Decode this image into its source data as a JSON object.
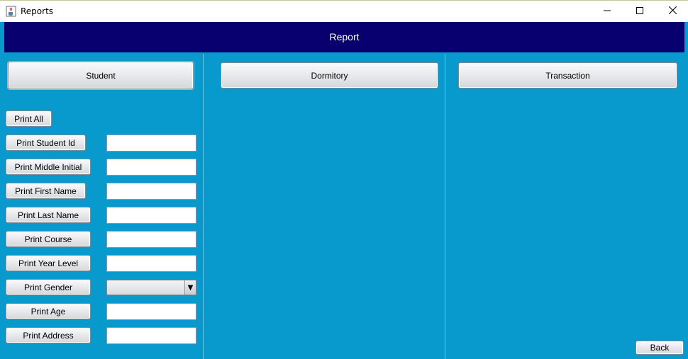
{
  "window": {
    "title": "Reports",
    "minimize_glyph": "─",
    "close_glyph": "✕"
  },
  "header": {
    "title": "Report"
  },
  "tabs": {
    "student": "Student",
    "dormitory": "Dormitory",
    "transaction": "Transaction"
  },
  "student_panel": {
    "print_all": "Print All",
    "rows": [
      {
        "label": "Print Student Id",
        "value": ""
      },
      {
        "label": "Print Middle Initial",
        "value": ""
      },
      {
        "label": "Print First Name",
        "value": ""
      },
      {
        "label": "Print Last Name",
        "value": ""
      },
      {
        "label": "Print Course",
        "value": ""
      },
      {
        "label": "Print Year Level",
        "value": ""
      },
      {
        "label": "Print Gender",
        "value": ""
      },
      {
        "label": "Print Age",
        "value": ""
      },
      {
        "label": "Print Address",
        "value": ""
      }
    ],
    "gender_arrow": "▼"
  },
  "footer": {
    "back": "Back"
  },
  "colors": {
    "panel_bg": "#0899cd",
    "header_bg": "#07006e",
    "header_text": "#ffffff"
  },
  "icons": {
    "app": "java-coffee-cup-icon",
    "minimize": "minimize-icon",
    "maximize": "maximize-icon",
    "close": "close-icon",
    "dropdown": "chevron-down-icon"
  }
}
